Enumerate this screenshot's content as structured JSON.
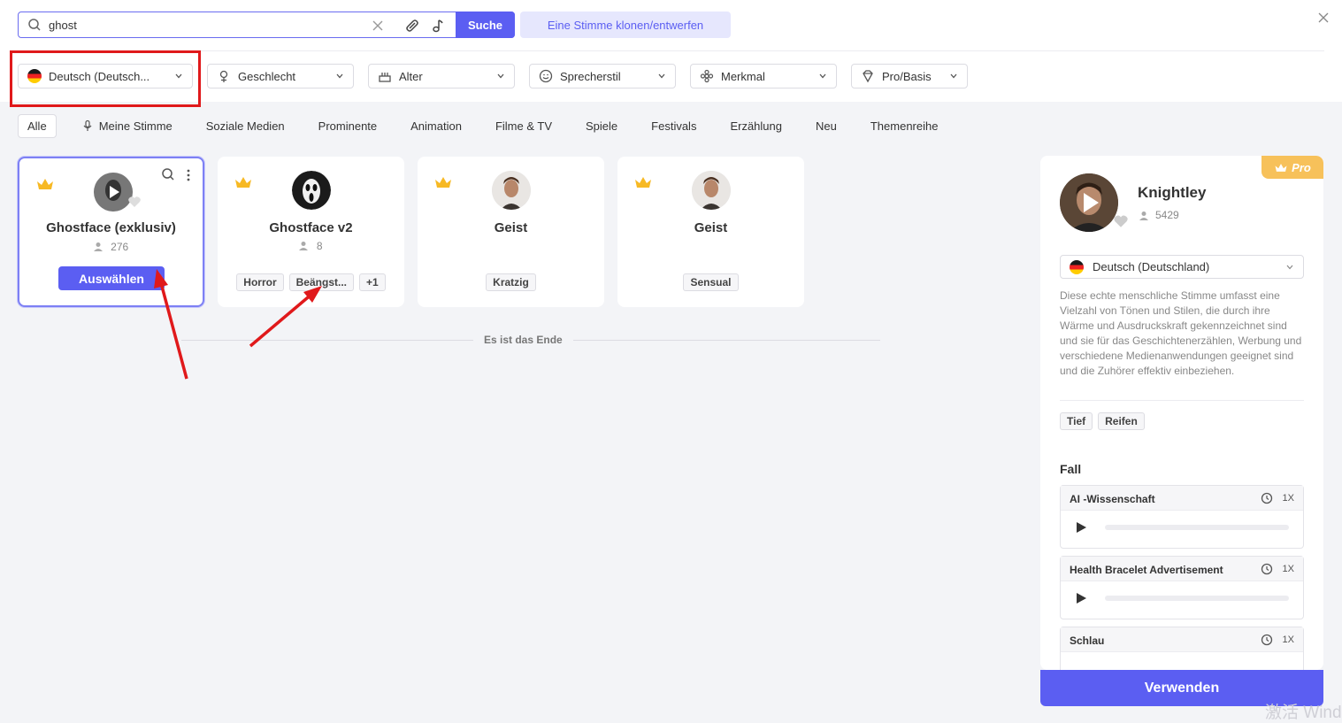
{
  "search": {
    "value": "ghost",
    "button_label": "Suche"
  },
  "clone_button": "Eine Stimme klonen/entwerfen",
  "filters": {
    "language": "Deutsch (Deutsch...",
    "gender": "Geschlecht",
    "age": "Alter",
    "style": "Sprecherstil",
    "feature": "Merkmal",
    "tier": "Pro/Basis"
  },
  "categories": [
    "Alle",
    "Meine Stimme",
    "Soziale Medien",
    "Prominente",
    "Animation",
    "Filme & TV",
    "Spiele",
    "Festivals",
    "Erzählung",
    "Neu",
    "Themenreihe"
  ],
  "cards": [
    {
      "name": "Ghostface (exklusiv)",
      "count": "276",
      "button": "Auswählen"
    },
    {
      "name": "Ghostface v2",
      "count": "8",
      "tags": [
        "Horror",
        "Beängst...",
        "+1"
      ]
    },
    {
      "name": "Geist",
      "tags": [
        "Kratzig"
      ]
    },
    {
      "name": "Geist",
      "tags": [
        "Sensual"
      ]
    }
  ],
  "end_text": "Es ist das Ende",
  "panel": {
    "badge": "Pro",
    "name": "Knightley",
    "count": "5429",
    "language": "Deutsch (Deutschland)",
    "description": "Diese echte menschliche Stimme umfasst eine Vielzahl von Tönen und Stilen, die durch ihre Wärme und Ausdruckskraft gekennzeichnet sind und sie für das Geschichtenerzählen, Werbung und verschiedene Medienanwendungen geeignet sind und die Zuhörer effektiv einbeziehen.",
    "tags": [
      "Tief",
      "Reifen"
    ],
    "section_title": "Fall",
    "samples": [
      {
        "title": "AI -Wissenschaft",
        "speed": "1X"
      },
      {
        "title": "Health Bracelet Advertisement",
        "speed": "1X"
      },
      {
        "title": "Schlau",
        "speed": "1X"
      }
    ],
    "use_button": "Verwenden"
  },
  "watermark": "激活 Wind",
  "colors": {
    "accent": "#5b5ef2",
    "highlight": "#e0191b",
    "crown": "#f7b924"
  }
}
